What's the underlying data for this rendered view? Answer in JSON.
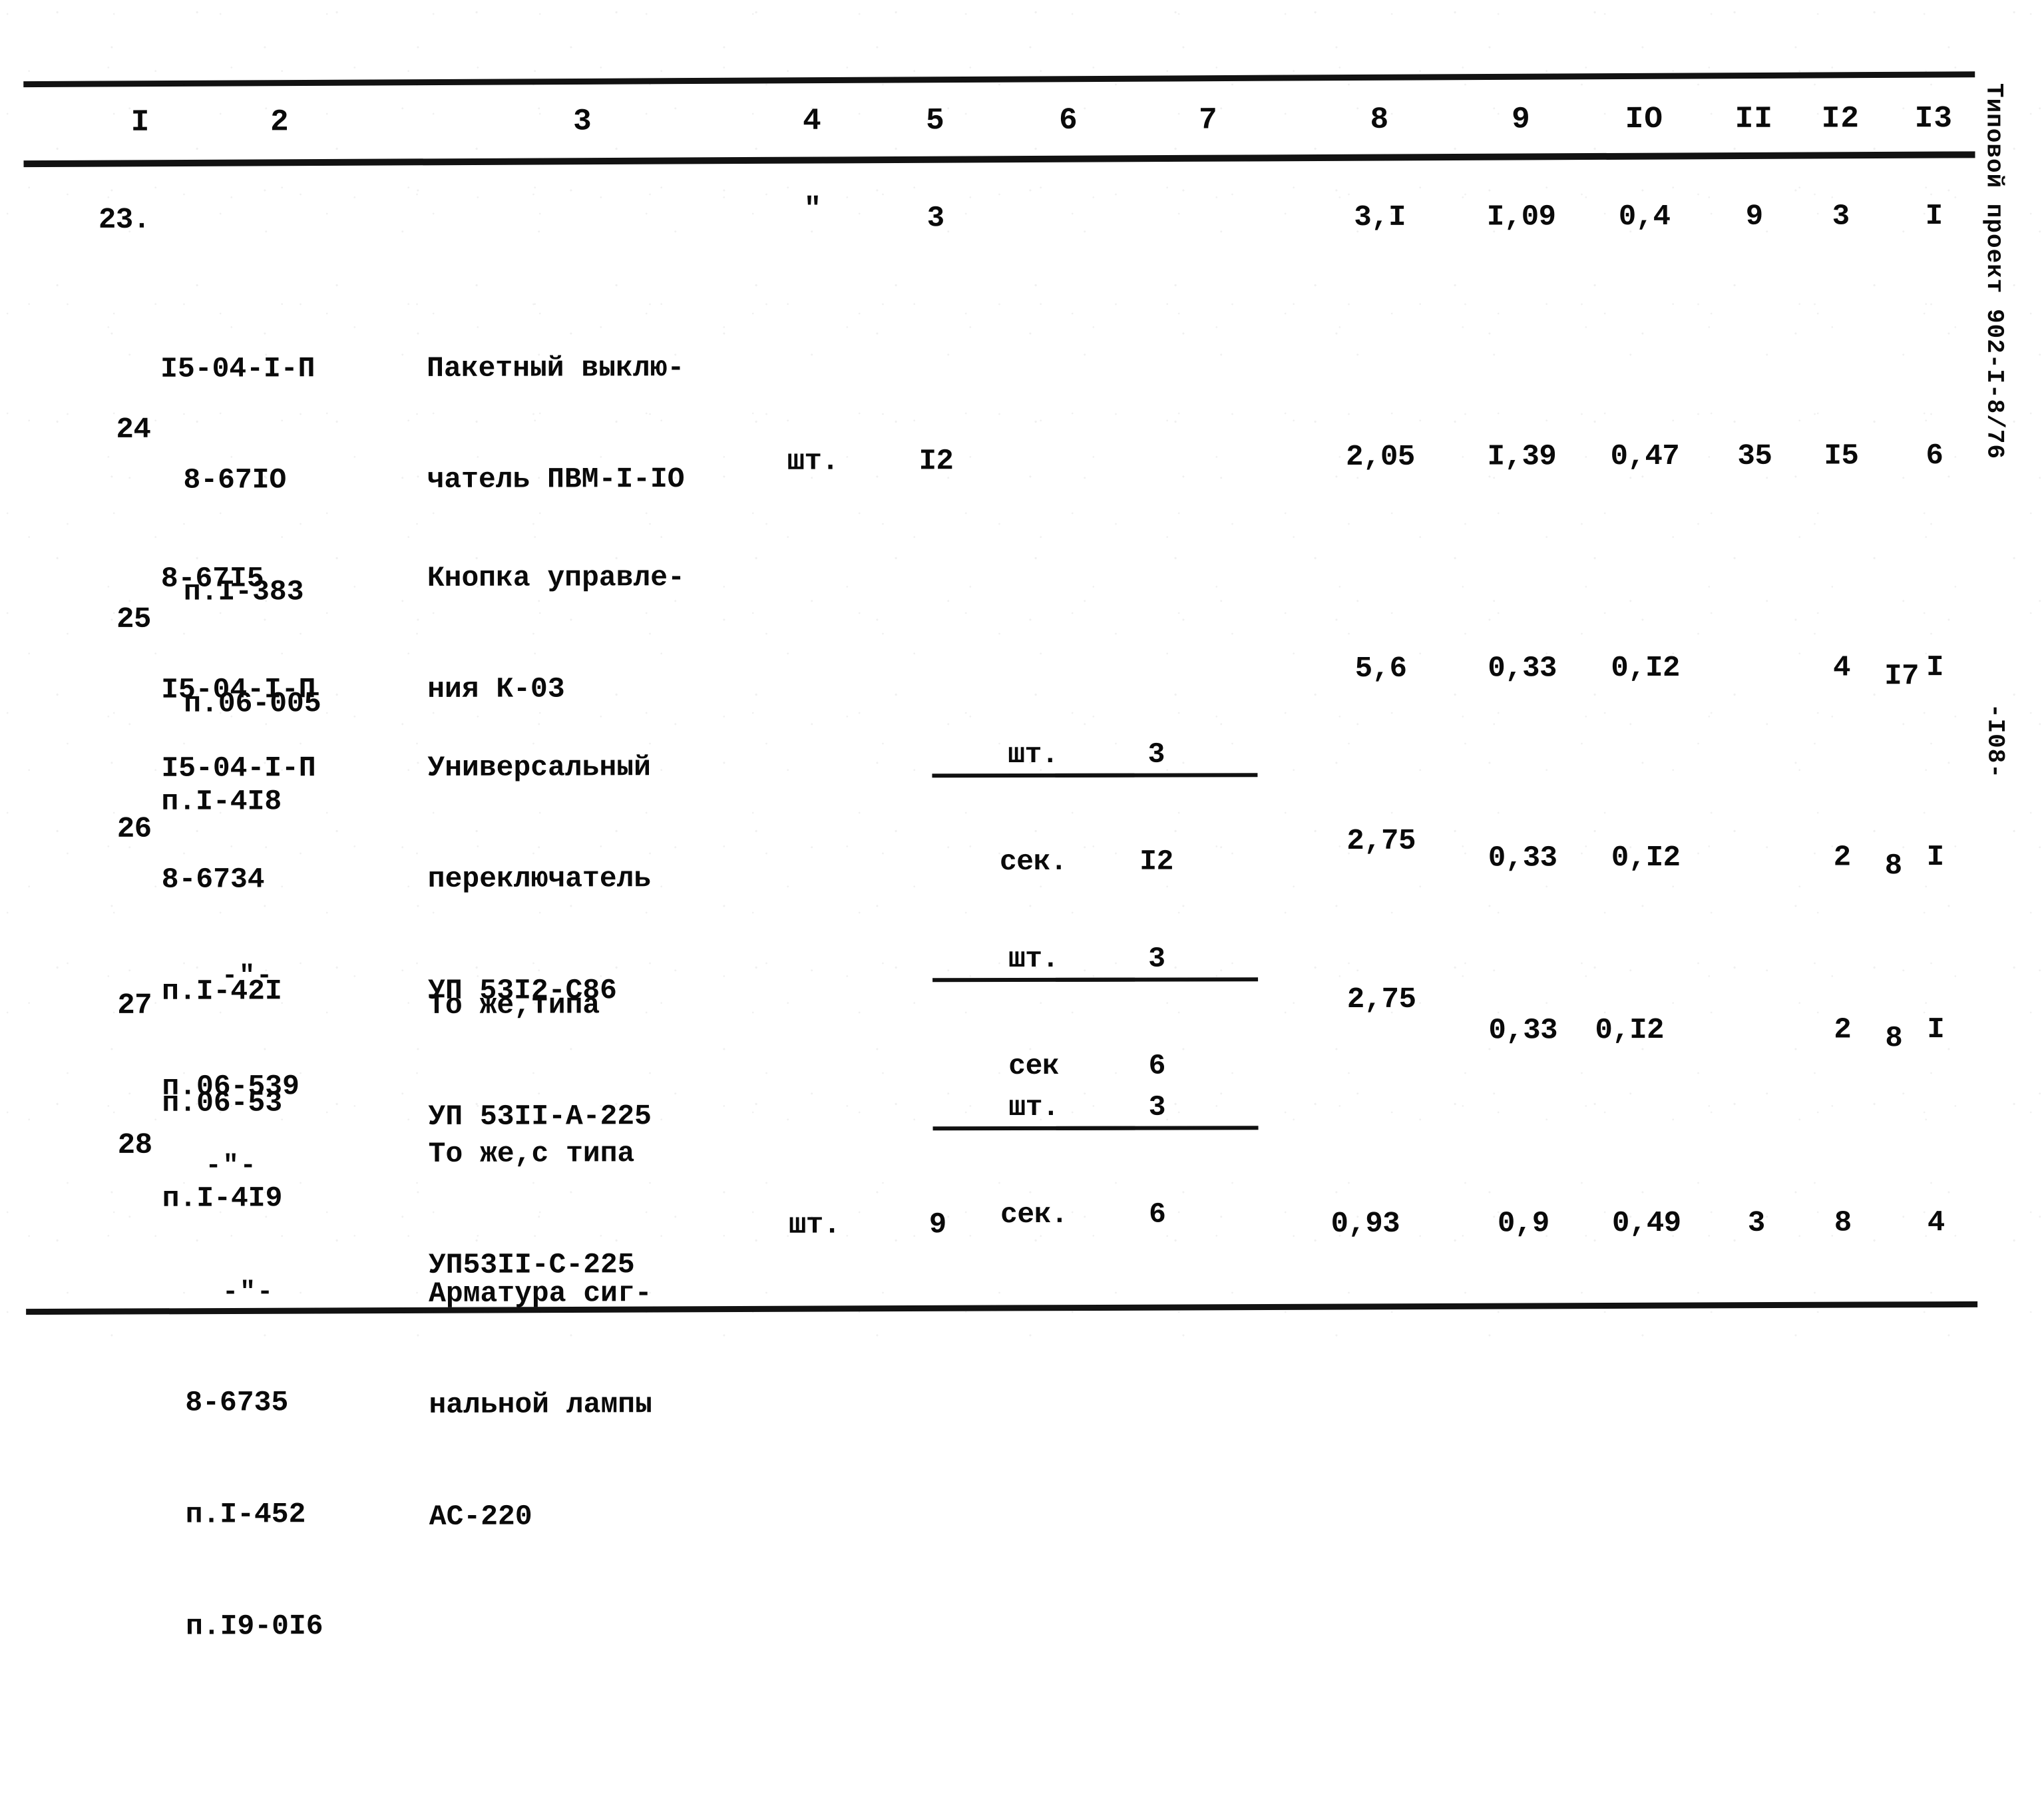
{
  "document": {
    "kind": "scanned-estimate-table",
    "margin_code": "Типовой проект 902-I-8/76",
    "margin_page": "-I08-"
  },
  "table": {
    "column_headers": [
      "I",
      "2",
      "3",
      "4",
      "5",
      "6",
      "7",
      "8",
      "9",
      "IO",
      "II",
      "I2",
      "I3"
    ],
    "rows": [
      {
        "index": "23.",
        "codes": [
          "I5-04-I-П",
          "8-67IO",
          "п.I-383",
          "п.06-005"
        ],
        "description": [
          "Пакетный выклю-",
          "чатель ПВМ-I-IO"
        ],
        "unit": "\"",
        "unit_is_fraction": false,
        "quantity": "3",
        "quantity_is_fraction": false,
        "col6": "",
        "col7": "",
        "col8": "3,I",
        "col9": "I,09",
        "col10": "0,4",
        "col11": "9",
        "col11_raised": false,
        "col12": "3",
        "col13": "I"
      },
      {
        "index": "24",
        "codes": [
          "8-67I5",
          "I5-04-I-П",
          "п.I-4I8"
        ],
        "description": [
          "Кнопка управле-",
          "ния К-03"
        ],
        "unit": "шт.",
        "unit_is_fraction": false,
        "quantity": "I2",
        "quantity_is_fraction": false,
        "col6": "",
        "col7": "",
        "col8": "2,05",
        "col9": "I,39",
        "col10": "0,47",
        "col11": "35",
        "col11_raised": false,
        "col12": "I5",
        "col13": "6"
      },
      {
        "index": "25",
        "codes": [
          "I5-04-I-П",
          "8-6734",
          "п.I-42I",
          "п.06-53"
        ],
        "description": [
          "Универсальный",
          "переключатель",
          "УП 53I2-С86"
        ],
        "unit": "шт.",
        "unit_denominator": "сек.",
        "unit_is_fraction": true,
        "quantity": "3",
        "quantity_denominator": "I2",
        "quantity_is_fraction": true,
        "col6": "",
        "col7": "",
        "col8": "5,6",
        "col9": "0,33",
        "col10": "0,I2",
        "col11": "I7",
        "col11_raised": true,
        "col12": "4",
        "col13": "I"
      },
      {
        "index": "26",
        "codes": [
          "-\"-",
          "п.06-539",
          "п.I-4I9"
        ],
        "description": [
          "То же,типа",
          "УП 53II-А-225"
        ],
        "unit": "шт.",
        "unit_denominator": "сек",
        "unit_is_fraction": true,
        "quantity": "3",
        "quantity_denominator": "6",
        "quantity_is_fraction": true,
        "col6": "",
        "col7": "",
        "col8": "2,75",
        "col9": "0,33",
        "col10": "0,I2",
        "col11": "8",
        "col11_raised": true,
        "col12": "2",
        "col13": "I"
      },
      {
        "index": "27",
        "codes": [
          "-\"-"
        ],
        "description": [
          "То же,с типа",
          "УП53II-С-225"
        ],
        "unit": "шт.",
        "unit_denominator": "сек.",
        "unit_is_fraction": true,
        "quantity": "3",
        "quantity_denominator": "6",
        "quantity_is_fraction": true,
        "col6": "",
        "col7": "",
        "col8": "2,75",
        "col9": "0,33",
        "col10": "0,I2",
        "col11": "8",
        "col11_raised": true,
        "col12": "2",
        "col13": "I"
      },
      {
        "index": "28",
        "codes": [
          "-\"-",
          "8-6735",
          "п.I-452",
          "п.I9-0I6"
        ],
        "description": [
          "Арматура сиг-",
          "нальной лампы",
          "АС-220"
        ],
        "unit": "шт.",
        "unit_is_fraction": false,
        "quantity": "9",
        "quantity_is_fraction": false,
        "col6": "",
        "col7": "",
        "col8": "0,93",
        "col9": "0,9",
        "col10": "0,49",
        "col11": "3",
        "col11_raised": false,
        "col12": "8",
        "col13": "4"
      }
    ]
  }
}
